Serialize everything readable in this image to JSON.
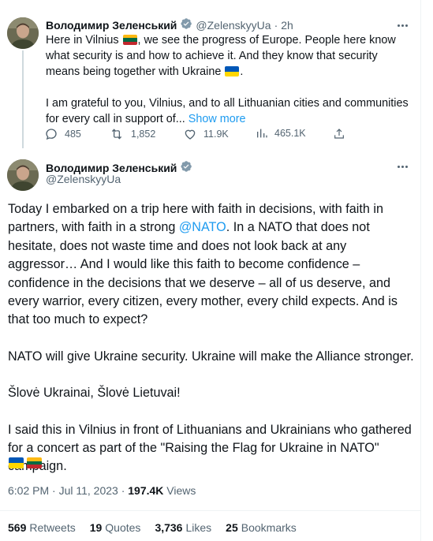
{
  "tweet1": {
    "author_name": "Володимир Зеленський",
    "handle": "@ZelenskyyUa",
    "separator": "·",
    "time": "2h",
    "line1_a": "Here in Vilnius ",
    "line1_b": ", we see the progress of Europe. People here know what security is and how to achieve it. And they know that security means being together with Ukraine ",
    "line1_c": ".",
    "para2": "I am grateful to you, Vilnius, and to all Lithuanian cities and communities for every call in support of...",
    "show_more": "Show more",
    "replies": "485",
    "retweets": "1,852",
    "likes": "11.9K",
    "views": "465.1K"
  },
  "tweet2": {
    "author_name": "Володимир Зеленський",
    "handle": "@ZelenskyyUa",
    "para1_a": "Today I embarked on a trip here with faith in decisions, with faith in partners, with faith in a strong ",
    "mention": "@NATO",
    "para1_b": ". In a NATO that does not hesitate, does not waste time and does not look back at any aggressor… And I would like this faith to become confidence – confidence in the decisions that we deserve – all of us deserve, and every warrior, every citizen, every mother, every child expects. And is that too much to expect?",
    "para2": "NATO will give Ukraine security. Ukraine will make the Alliance stronger.",
    "para3": "Šlovė Ukrainai, Šlovė Lietuvai!",
    "para4": "I said this in Vilnius in front of Lithuanians and Ukrainians who gathered for a concert as part of the \"Raising the Flag for Ukraine in NATO\" campaign.",
    "timestamp": "6:02 PM · Jul 11, 2023 · ",
    "views_count": "197.4K",
    "views_label": " Views",
    "stats": [
      {
        "count": "569",
        "label": "Retweets"
      },
      {
        "count": "19",
        "label": "Quotes"
      },
      {
        "count": "3,736",
        "label": "Likes"
      },
      {
        "count": "25",
        "label": "Bookmarks"
      }
    ]
  },
  "icons": {
    "verified": "verified-badge-icon",
    "more": "more-icon",
    "reply": "reply-icon",
    "retweet": "retweet-icon",
    "like": "like-icon",
    "views": "views-icon",
    "share": "share-icon"
  },
  "colors": {
    "accent": "#1d9bf0",
    "muted": "#536471",
    "text": "#0f1419",
    "flag_ua_blue": "#0057b7",
    "flag_ua_yellow": "#ffd700",
    "flag_lt_yellow": "#fdb913",
    "flag_lt_green": "#006a44",
    "flag_lt_red": "#c1272d"
  }
}
